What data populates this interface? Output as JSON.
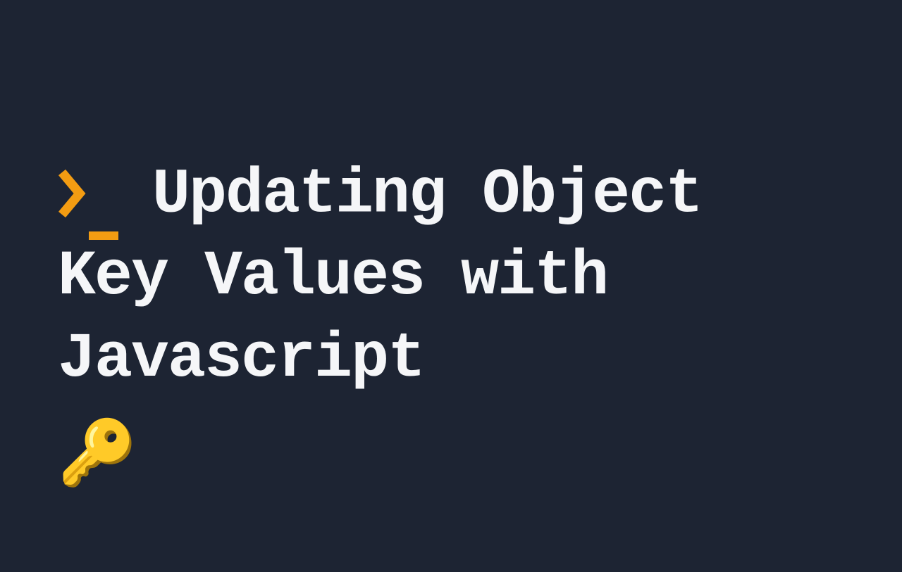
{
  "slide": {
    "prompt": {
      "chevron": "❯",
      "underscore": "_",
      "color": "#f39c12"
    },
    "title": "Updating Object Key Values with Javascript",
    "emoji": "🔑",
    "background_color": "#1d2433",
    "text_color": "#f5f6f8"
  }
}
